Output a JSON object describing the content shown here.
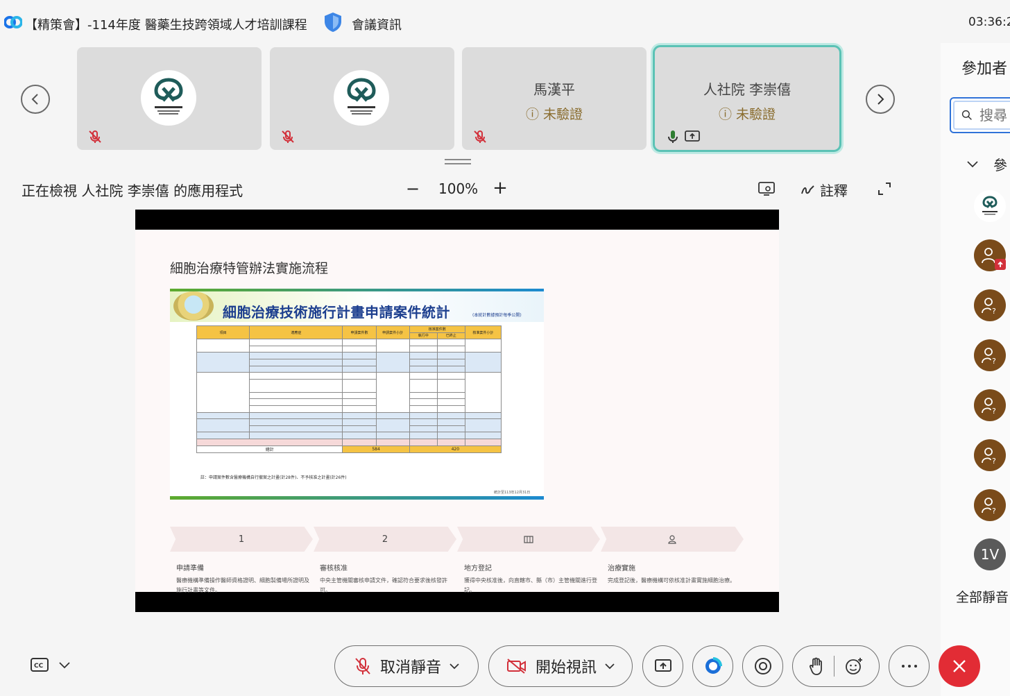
{
  "titlebar": {
    "meeting_title": "【精策會】-114年度 醫藥生技跨領域人才培訓課程",
    "meeting_info": "會議資訊",
    "clock": "03:36:2"
  },
  "participants": [
    {
      "kind": "logo",
      "name": "",
      "status": "",
      "muted": true
    },
    {
      "kind": "logo",
      "name": "",
      "status": "",
      "muted": true
    },
    {
      "kind": "text",
      "name": "馬漢平",
      "status": "未驗證",
      "muted": true
    },
    {
      "kind": "text",
      "name": "人社院 李崇僖",
      "status": "未驗證",
      "muted": false,
      "active": true
    }
  ],
  "viewer": {
    "viewing_text": "正在檢視 人社院 李崇僖 的應用程式",
    "zoom_out": "−",
    "zoom_level": "100%",
    "zoom_in": "+",
    "annotate_label": "註釋"
  },
  "slide": {
    "title": "細胞治療特管辦法實施流程",
    "image_heading": "細胞治療技術施行計畫申請案件統計",
    "image_heading_note": "(本統計數據預計每季公開)",
    "table": {
      "header": [
        "項目",
        "適應症",
        "申請案件數",
        "申請案件小計",
        "核准案件數",
        "核准案件小計"
      ],
      "subheader": [
        "執行中",
        "已終止"
      ],
      "total_label": "總計",
      "total_applied": "584",
      "total_approved": "420"
    },
    "footnote": "註：申請案件數含醫療機構自行撤案之計畫(計28件)、不予核准之計畫(計26件)",
    "date_note": "統計至113年12月31日",
    "steps": [
      {
        "marker": "1",
        "title": "申請準備",
        "desc": "醫療機構準備操作醫師資格證明、細胞製備場所證明及施行計畫等文件。"
      },
      {
        "marker": "2",
        "title": "審核核准",
        "desc": "中央主管機關審核申請文件，確認符合要求後核發許可。"
      },
      {
        "marker": "",
        "title": "地方登記",
        "desc": "獲得中央核准後，向直轄市、縣（市）主管機關進行登記。"
      },
      {
        "marker": "",
        "title": "治療實施",
        "desc": "完成登記後，醫療機構可依核准計畫實施細胞治療。"
      }
    ]
  },
  "panel": {
    "title": "參加者",
    "search_placeholder": "搜尋",
    "group_label": "參",
    "avatar_1v": "1V",
    "mute_all": "全部靜音"
  },
  "controls": {
    "unmute_label": "取消靜音",
    "video_label": "開始視訊"
  },
  "colors": {
    "accent": "#2f72d8",
    "active_tile": "#5bc2b5",
    "end_call": "#e22c35",
    "unverified": "#8a6d2f"
  }
}
